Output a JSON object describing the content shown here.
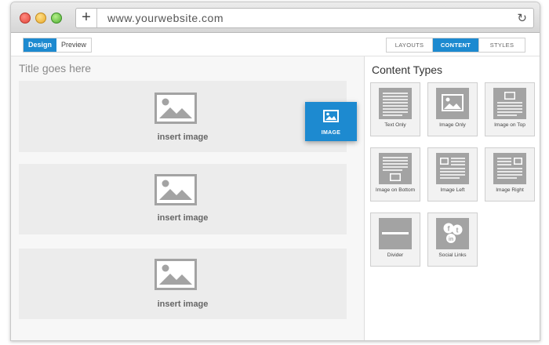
{
  "browser": {
    "url": "www.yourwebsite.com",
    "new_tab_symbol": "+",
    "refresh_symbol": "↻"
  },
  "editor": {
    "mode_design": "Design",
    "mode_preview": "Preview",
    "tabs": [
      "LAYOUTS",
      "CONTENT",
      "STYLES"
    ],
    "active_tab": "CONTENT"
  },
  "canvas": {
    "title": "Title goes here",
    "blocks": [
      {
        "label": "insert image"
      },
      {
        "label": "insert image"
      },
      {
        "label": "insert image"
      }
    ]
  },
  "drag_item": {
    "label": "IMAGE"
  },
  "content_panel": {
    "title": "Content Types",
    "items": [
      {
        "label": "Text Only",
        "icon": "text-only-icon"
      },
      {
        "label": "Image Only",
        "icon": "image-only-icon"
      },
      {
        "label": "Image on Top",
        "icon": "image-on-top-icon"
      },
      {
        "label": "Image on Bottom",
        "icon": "image-on-bottom-icon"
      },
      {
        "label": "Image Left",
        "icon": "image-left-icon"
      },
      {
        "label": "Image Right",
        "icon": "image-right-icon"
      },
      {
        "label": "Divider",
        "icon": "divider-icon"
      },
      {
        "label": "Social Links",
        "icon": "social-links-icon"
      }
    ]
  },
  "colors": {
    "accent": "#1d8ad0",
    "block_bg": "#ececec",
    "icon_gray": "#a3a3a3"
  }
}
